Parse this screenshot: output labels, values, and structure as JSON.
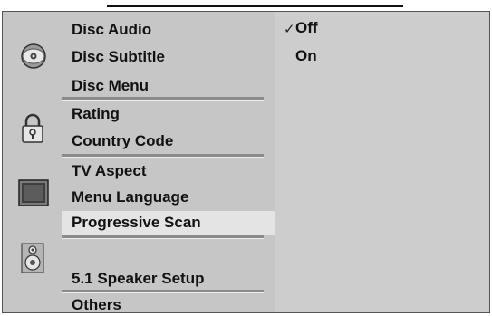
{
  "menu": {
    "groups": [
      {
        "icon": "disc-icon",
        "items": [
          "Disc Audio",
          "Disc Subtitle",
          "Disc Menu"
        ]
      },
      {
        "icon": "lock-icon",
        "items": [
          "Rating",
          "Country Code"
        ]
      },
      {
        "icon": "tv-icon",
        "items": [
          "TV Aspect",
          "Menu Language",
          "Progressive Scan"
        ]
      },
      {
        "icon": "speaker-icon",
        "items": [
          "5.1 Speaker Setup"
        ]
      },
      {
        "icon": "",
        "items": [
          "Others"
        ]
      }
    ],
    "selected": "Progressive Scan"
  },
  "options": {
    "items": [
      "Off",
      "On"
    ],
    "checked": "Off",
    "check_mark": "✓"
  }
}
